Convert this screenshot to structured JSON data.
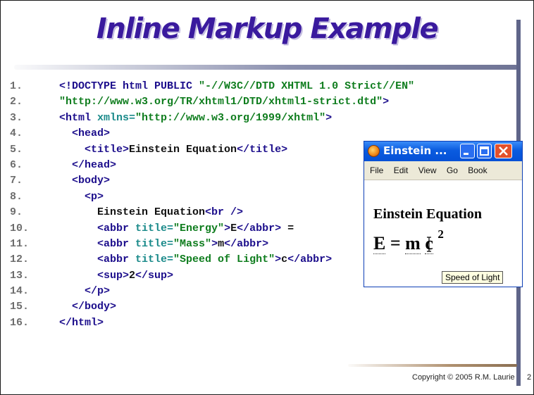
{
  "slide": {
    "title": "Inline Markup Example",
    "copyright": "Copyright © 2005  R.M. Laurie",
    "page_number": "2"
  },
  "code_lines": [
    {
      "num": "1.",
      "segs": [
        {
          "c": "tg",
          "t": "<!DOCTYPE html PUBLIC "
        },
        {
          "c": "vl",
          "t": "\"-//W3C//DTD XHTML 1.0 Strict//EN\""
        }
      ]
    },
    {
      "num": "2.",
      "segs": [
        {
          "c": "vl",
          "t": "\"http://www.w3.org/TR/xhtml1/DTD/xhtml1-strict.dtd\""
        },
        {
          "c": "tg",
          "t": ">"
        }
      ]
    },
    {
      "num": "3.",
      "segs": [
        {
          "c": "tg",
          "t": "<html "
        },
        {
          "c": "at",
          "t": "xmlns="
        },
        {
          "c": "vl",
          "t": "\"http://www.w3.org/1999/xhtml\""
        },
        {
          "c": "tg",
          "t": ">"
        }
      ]
    },
    {
      "num": "4.",
      "segs": [
        {
          "c": "tx",
          "t": "  "
        },
        {
          "c": "tg",
          "t": "<head>"
        }
      ]
    },
    {
      "num": "5.",
      "segs": [
        {
          "c": "tx",
          "t": "    "
        },
        {
          "c": "tg",
          "t": "<title>"
        },
        {
          "c": "tx",
          "t": "Einstein Equation"
        },
        {
          "c": "tg",
          "t": "</title>"
        }
      ]
    },
    {
      "num": "6.",
      "segs": [
        {
          "c": "tx",
          "t": "  "
        },
        {
          "c": "tg",
          "t": "</head>"
        }
      ]
    },
    {
      "num": "7.",
      "segs": [
        {
          "c": "tx",
          "t": "  "
        },
        {
          "c": "tg",
          "t": "<body>"
        }
      ]
    },
    {
      "num": "8.",
      "segs": [
        {
          "c": "tx",
          "t": "    "
        },
        {
          "c": "tg",
          "t": "<p>"
        }
      ]
    },
    {
      "num": "9.",
      "segs": [
        {
          "c": "tx",
          "t": "      Einstein Equation"
        },
        {
          "c": "tg",
          "t": "<br />"
        }
      ]
    },
    {
      "num": "10.",
      "segs": [
        {
          "c": "tx",
          "t": "      "
        },
        {
          "c": "tg",
          "t": "<abbr "
        },
        {
          "c": "at",
          "t": "title="
        },
        {
          "c": "vl",
          "t": "\"Energy\""
        },
        {
          "c": "tg",
          "t": ">"
        },
        {
          "c": "tx",
          "t": "E"
        },
        {
          "c": "tg",
          "t": "</abbr>"
        },
        {
          "c": "tx",
          "t": " ="
        }
      ]
    },
    {
      "num": "11.",
      "segs": [
        {
          "c": "tx",
          "t": "      "
        },
        {
          "c": "tg",
          "t": "<abbr "
        },
        {
          "c": "at",
          "t": "title="
        },
        {
          "c": "vl",
          "t": "\"Mass\""
        },
        {
          "c": "tg",
          "t": ">"
        },
        {
          "c": "tx",
          "t": "m"
        },
        {
          "c": "tg",
          "t": "</abbr>"
        }
      ]
    },
    {
      "num": "12.",
      "segs": [
        {
          "c": "tx",
          "t": "      "
        },
        {
          "c": "tg",
          "t": "<abbr "
        },
        {
          "c": "at",
          "t": "title="
        },
        {
          "c": "vl",
          "t": "\"Speed of Light\""
        },
        {
          "c": "tg",
          "t": ">"
        },
        {
          "c": "tx",
          "t": "c"
        },
        {
          "c": "tg",
          "t": "</abbr>"
        }
      ]
    },
    {
      "num": "13.",
      "segs": [
        {
          "c": "tx",
          "t": "      "
        },
        {
          "c": "tg",
          "t": "<sup>"
        },
        {
          "c": "tx",
          "t": "2"
        },
        {
          "c": "tg",
          "t": "</sup>"
        }
      ]
    },
    {
      "num": "14.",
      "segs": [
        {
          "c": "tx",
          "t": "    "
        },
        {
          "c": "tg",
          "t": "</p>"
        }
      ]
    },
    {
      "num": "15.",
      "segs": [
        {
          "c": "tx",
          "t": "  "
        },
        {
          "c": "tg",
          "t": "</body>"
        }
      ]
    },
    {
      "num": "16.",
      "segs": [
        {
          "c": "tg",
          "t": "</html>"
        }
      ]
    }
  ],
  "browser": {
    "title": "Einstein ...",
    "menu": [
      "File",
      "Edit",
      "View",
      "Go",
      "Book"
    ],
    "heading": "Einstein Equation",
    "formula": {
      "e": "E",
      "eq": "=",
      "m": "m",
      "c": "c",
      "exp": "2"
    },
    "tooltip": "Speed of Light",
    "icons": [
      "firefox-icon",
      "minimize-icon",
      "maximize-icon",
      "close-icon"
    ]
  }
}
